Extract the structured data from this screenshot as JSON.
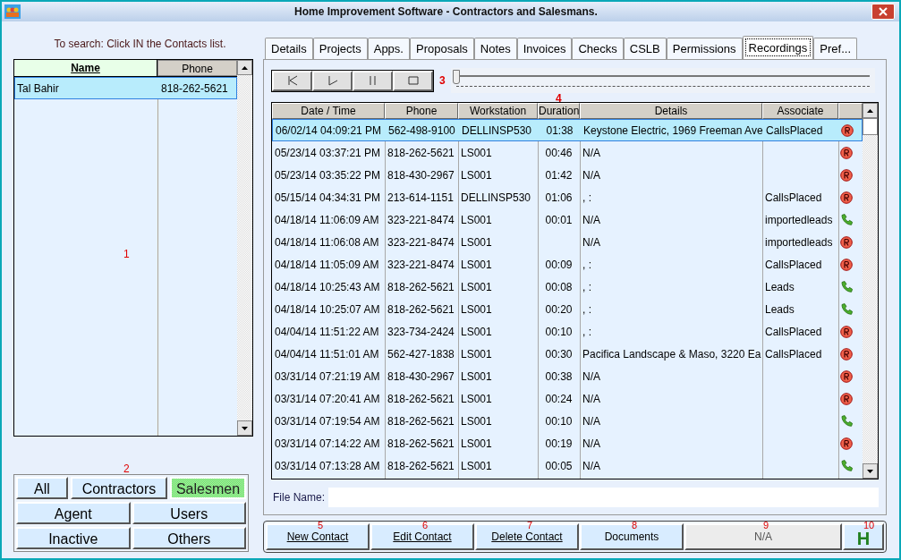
{
  "window": {
    "title": "Home Improvement Software - Contractors and Salesmans."
  },
  "search_hint": "To search: Click IN the Contacts list.",
  "contacts": {
    "marker": "1",
    "columns": [
      "Name",
      "Phone"
    ],
    "rows": [
      {
        "name": "Tal Bahir",
        "phone": "818-262-5621",
        "selected": true
      }
    ]
  },
  "filters": {
    "marker": "2",
    "buttons": [
      {
        "label": "All",
        "selected": false
      },
      {
        "label": "Contractors",
        "selected": false
      },
      {
        "label": "Salesmen",
        "selected": true
      },
      {
        "label": "Agent",
        "selected": false
      },
      {
        "label": "Users",
        "selected": false
      },
      {
        "label": "Inactive",
        "selected": false
      },
      {
        "label": "Others",
        "selected": false
      }
    ]
  },
  "tabs": [
    {
      "label": "Details",
      "selected": false
    },
    {
      "label": "Projects",
      "selected": false
    },
    {
      "label": "Apps.",
      "selected": false
    },
    {
      "label": "Proposals",
      "selected": false
    },
    {
      "label": "Notes",
      "selected": false
    },
    {
      "label": "Invoices",
      "selected": false
    },
    {
      "label": "Checks",
      "selected": false
    },
    {
      "label": "CSLB",
      "selected": false
    },
    {
      "label": "Permissions",
      "selected": false
    },
    {
      "label": "Recordings",
      "selected": true
    },
    {
      "label": "Pref...",
      "selected": false
    }
  ],
  "player": {
    "marker": "3",
    "level": 0
  },
  "recordings": {
    "marker": "4",
    "columns": [
      "Date / Time",
      "Phone",
      "Workstation",
      "Duration",
      "Details",
      "Associate"
    ],
    "rows": [
      {
        "datetime": "06/02/14 04:09:21 PM",
        "phone": "562-498-9100",
        "workstation": "DELLINSP530",
        "duration": "01:38",
        "details": "Keystone Electric, 1969 Freeman Ave",
        "associate": "CallsPlaced",
        "kind": "record",
        "selected": true
      },
      {
        "datetime": "05/23/14 03:37:21 PM",
        "phone": "818-262-5621",
        "workstation": "LS001",
        "duration": "00:46",
        "details": "N/A",
        "kind": "record",
        "selected": false
      },
      {
        "datetime": "05/23/14 03:35:22 PM",
        "phone": "818-430-2967",
        "workstation": "LS001",
        "duration": "01:42",
        "details": "N/A",
        "kind": "record",
        "selected": false
      },
      {
        "datetime": "05/15/14 04:34:31 PM",
        "phone": "213-614-1151",
        "workstation": "DELLINSP530",
        "duration": "01:06",
        "details": ", :",
        "associate": "CallsPlaced",
        "kind": "record",
        "selected": false
      },
      {
        "datetime": "04/18/14 11:06:09 AM",
        "phone": "323-221-8474",
        "workstation": "LS001",
        "duration": "00:01",
        "details": "N/A",
        "associate": "importedleads",
        "kind": "call",
        "selected": false
      },
      {
        "datetime": "04/18/14 11:06:08 AM",
        "phone": "323-221-8474",
        "workstation": "LS001",
        "details": "N/A",
        "associate": "importedleads",
        "kind": "record",
        "selected": false
      },
      {
        "datetime": "04/18/14 11:05:09 AM",
        "phone": "323-221-8474",
        "workstation": "LS001",
        "duration": "00:09",
        "details": ", :",
        "associate": "CallsPlaced",
        "kind": "record",
        "selected": false
      },
      {
        "datetime": "04/18/14 10:25:43 AM",
        "phone": "818-262-5621",
        "workstation": "LS001",
        "duration": "00:08",
        "details": ", :",
        "associate": "Leads",
        "kind": "call",
        "selected": false
      },
      {
        "datetime": "04/18/14 10:25:07 AM",
        "phone": "818-262-5621",
        "workstation": "LS001",
        "duration": "00:20",
        "details": ", :",
        "associate": "Leads",
        "kind": "call",
        "selected": false
      },
      {
        "datetime": "04/04/14 11:51:22 AM",
        "phone": "323-734-2424",
        "workstation": "LS001",
        "duration": "00:10",
        "details": ", :",
        "associate": "CallsPlaced",
        "kind": "record",
        "selected": false
      },
      {
        "datetime": "04/04/14 11:51:01 AM",
        "phone": "562-427-1838",
        "workstation": "LS001",
        "duration": "00:30",
        "details": "Pacifica Landscape & Maso, 3220 Ea",
        "associate": "CallsPlaced",
        "kind": "record",
        "selected": false
      },
      {
        "datetime": "03/31/14 07:21:19 AM",
        "phone": "818-430-2967",
        "workstation": "LS001",
        "duration": "00:38",
        "details": "N/A",
        "kind": "record",
        "selected": false
      },
      {
        "datetime": "03/31/14 07:20:41 AM",
        "phone": "818-262-5621",
        "workstation": "LS001",
        "duration": "00:24",
        "details": "N/A",
        "kind": "record",
        "selected": false
      },
      {
        "datetime": "03/31/14 07:19:54 AM",
        "phone": "818-262-5621",
        "workstation": "LS001",
        "duration": "00:10",
        "details": "N/A",
        "kind": "call",
        "selected": false
      },
      {
        "datetime": "03/31/14 07:14:22 AM",
        "phone": "818-262-5621",
        "workstation": "LS001",
        "duration": "00:19",
        "details": "N/A",
        "kind": "record",
        "selected": false
      },
      {
        "datetime": "03/31/14 07:13:28 AM",
        "phone": "818-262-5621",
        "workstation": "LS001",
        "duration": "00:05",
        "details": "N/A",
        "kind": "call",
        "selected": false
      }
    ]
  },
  "file_name": {
    "label": "File Name:"
  },
  "actions": [
    {
      "label": "New Contact",
      "marker": "5",
      "kind": "button"
    },
    {
      "label": "Edit Contact",
      "marker": "6",
      "kind": "button"
    },
    {
      "label": "Delete Contact",
      "marker": "7",
      "kind": "button"
    },
    {
      "label": "Documents",
      "marker": "8",
      "kind": "button"
    },
    {
      "label": "N/A",
      "marker": "9",
      "kind": "status"
    },
    {
      "label": "H",
      "marker": "10",
      "kind": "help"
    }
  ]
}
